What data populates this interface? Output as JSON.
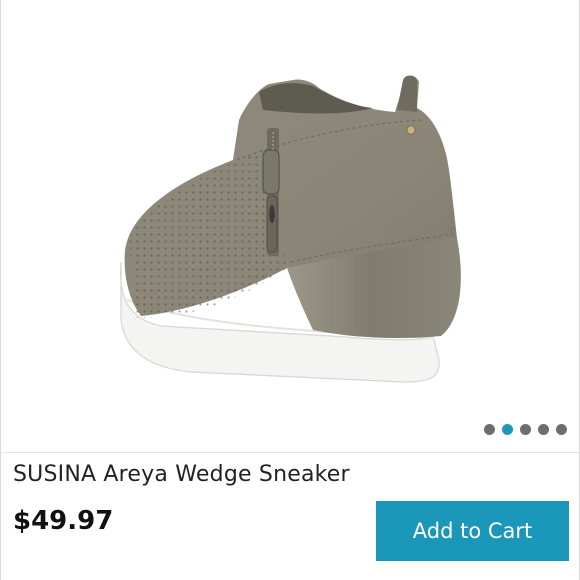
{
  "product": {
    "title": "SUSINA Areya Wedge Sneaker",
    "price": "$49.97",
    "image_icon": "wedge-sneaker-photo"
  },
  "carousel": {
    "total": 5,
    "active_index": 1
  },
  "actions": {
    "add_to_cart_label": "Add to Cart"
  },
  "colors": {
    "accent": "#1a97b8",
    "dot_inactive": "#6e6e6e",
    "shoe_suede": "#8c8778"
  }
}
